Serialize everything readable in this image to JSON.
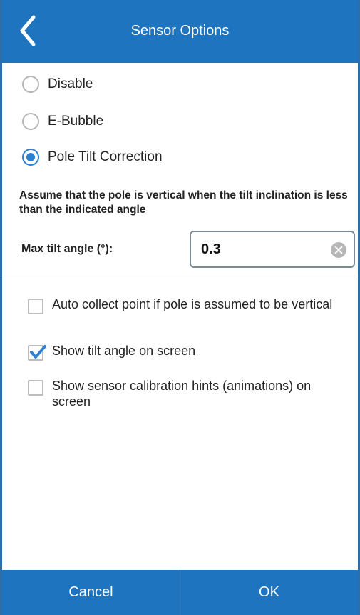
{
  "header": {
    "title": "Sensor Options",
    "back_icon": "chevron-left-icon"
  },
  "modes": [
    {
      "label": "Disable",
      "checked": false
    },
    {
      "label": "E-Bubble",
      "checked": false
    },
    {
      "label": "Pole Tilt Correction",
      "checked": true
    }
  ],
  "description": "Assume that the pole is vertical when the tilt inclination is less than the indicated angle",
  "max_tilt": {
    "label": "Max tilt angle (°):",
    "value": "0.3",
    "clear_icon": "clear-circle-icon"
  },
  "options": [
    {
      "label": "Auto collect point if pole is assumed to be vertical",
      "checked": false
    },
    {
      "label": "Show tilt angle on screen",
      "checked": true
    },
    {
      "label": "Show sensor calibration hints (animations) on screen",
      "checked": false
    }
  ],
  "footer": {
    "cancel_label": "Cancel",
    "ok_label": "OK"
  },
  "colors": {
    "primary": "#1f74bf",
    "accent": "#2d7fd0"
  }
}
